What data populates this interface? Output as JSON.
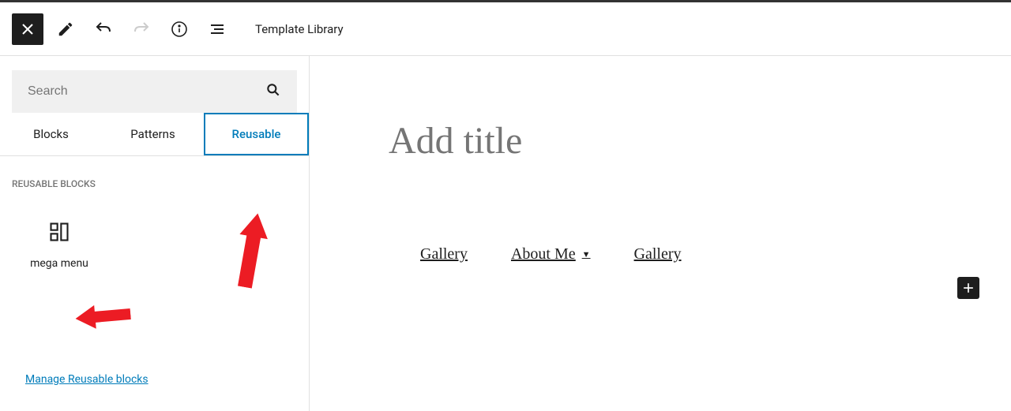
{
  "toolbar": {
    "template_library_label": "Template Library"
  },
  "sidebar": {
    "search_placeholder": "Search",
    "tabs": {
      "blocks": "Blocks",
      "patterns": "Patterns",
      "reusable": "Reusable"
    },
    "section_title": "Reusable Blocks",
    "block_item_label": "mega menu",
    "manage_link": "Manage Reusable blocks"
  },
  "editor": {
    "title_placeholder": "Add title",
    "nav_items": {
      "item1": "Gallery",
      "item2": "About Me",
      "item3": "Gallery"
    }
  }
}
